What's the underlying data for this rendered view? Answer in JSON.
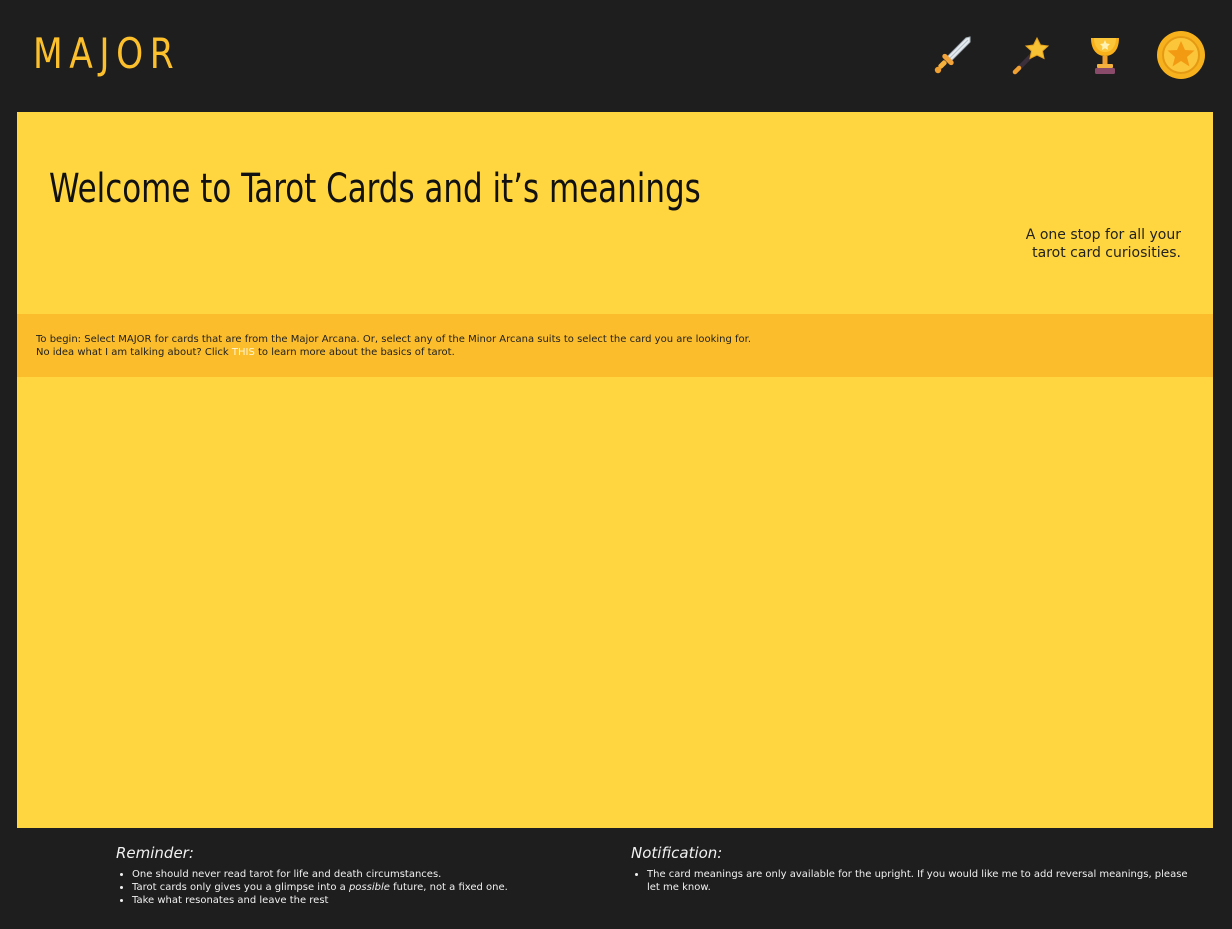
{
  "nav": {
    "logo": "MAJOR",
    "icons": [
      "sword-icon",
      "wand-icon",
      "trophy-cup-icon",
      "coin-star-icon"
    ]
  },
  "hero": {
    "title": "Welcome to Tarot Cards and it’s meanings",
    "subtitle_line1": "A one stop for all your",
    "subtitle_line2": "tarot card curiosities."
  },
  "instructions": {
    "line1": "To begin: Select MAJOR for cards that are from the Major Arcana. Or, select any of the Minor Arcana suits to select the card you are looking for.",
    "line2_prefix": "No idea what I am talking about? Click ",
    "link": "THIS",
    "line2_suffix": " to learn more about the basics of tarot."
  },
  "footer": {
    "reminder": {
      "heading": "Reminder:",
      "item1": "One should never read tarot for life and death circumstances.",
      "item2_prefix": "Tarot cards only gives you a glimpse into a ",
      "item2_em": "possible",
      "item2_suffix": " future, not a fixed one.",
      "item3": "Take what resonates and leave the rest"
    },
    "notification": {
      "heading": "Notification:",
      "item1": "The card meanings are only available for the upright. If you would like me to add reversal meanings, please let me know."
    }
  },
  "colors": {
    "background": "#1e1e1e",
    "accent": "#fcc02d",
    "main_panel": "#ffd63f",
    "instruction_band": "#fbbd2b"
  }
}
